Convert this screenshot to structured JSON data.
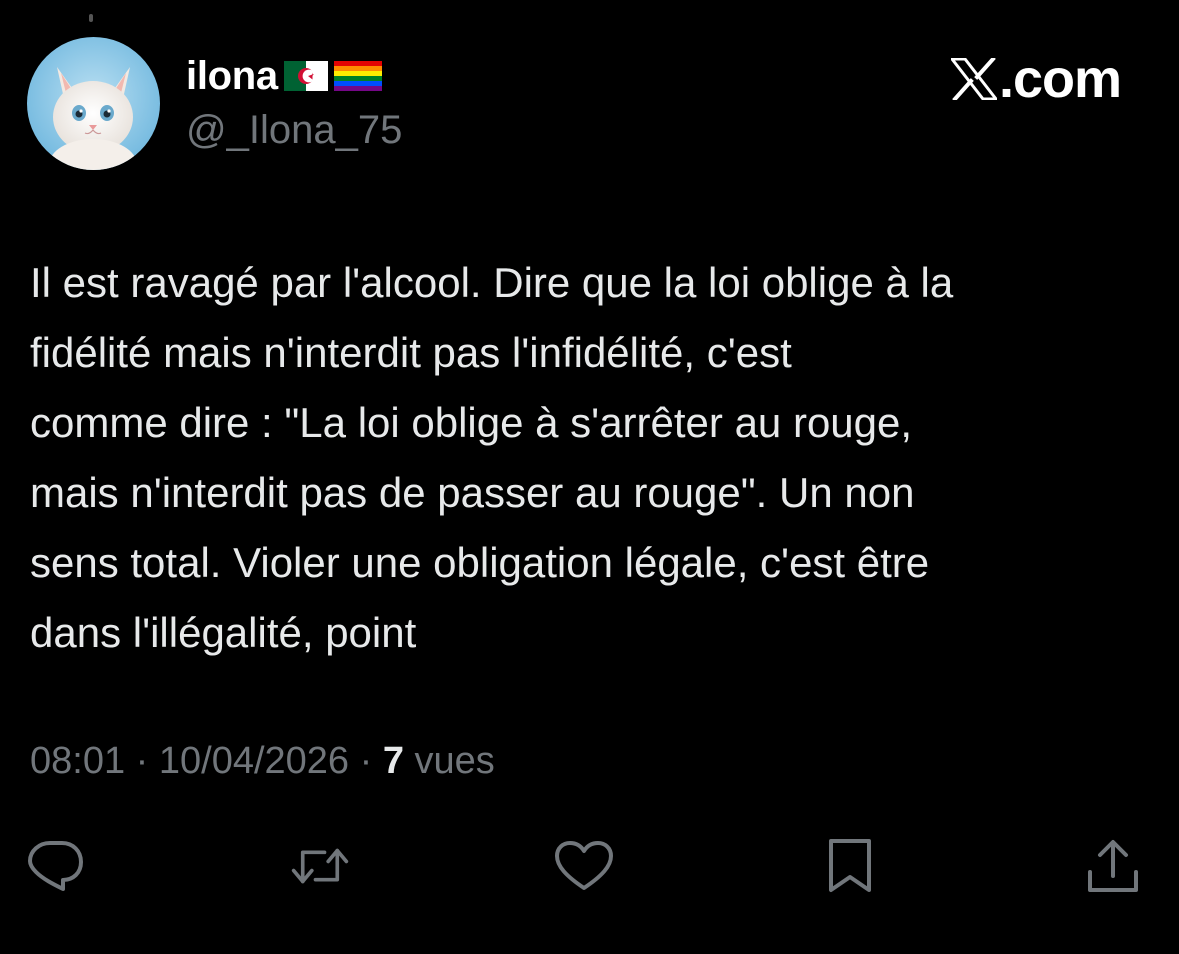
{
  "tweet": {
    "author": {
      "display_name": "ilona",
      "flags": [
        "algeria-flag",
        "rainbow-flag"
      ],
      "handle": "@_Ilona_75",
      "avatar": "white-kitten-avatar"
    },
    "brand": {
      "icon": "x-logo-icon",
      "domain": ".com"
    },
    "text": "Il est ravagé par l'alcool. Dire que la loi oblige à la\nfidélité mais n'interdit pas l'infidélité, c'est\ncomme dire : \"La loi oblige à s'arrêter au rouge,\nmais n'interdit pas de passer au rouge\". Un non\nsens total. Violer une obligation légale, c'est être\ndans l'illégalité, point",
    "time": "08:01",
    "separator": " · ",
    "date": "10/04/2026",
    "views_count": "7",
    "views_label": " vues"
  },
  "actions": [
    {
      "name": "reply",
      "icon": "reply-icon"
    },
    {
      "name": "retweet",
      "icon": "retweet-icon"
    },
    {
      "name": "like",
      "icon": "heart-icon"
    },
    {
      "name": "bookmark",
      "icon": "bookmark-icon"
    },
    {
      "name": "share",
      "icon": "share-icon"
    }
  ],
  "colors": {
    "background": "#000000",
    "primary_text": "#e7e9ea",
    "secondary_text": "#71767b"
  }
}
